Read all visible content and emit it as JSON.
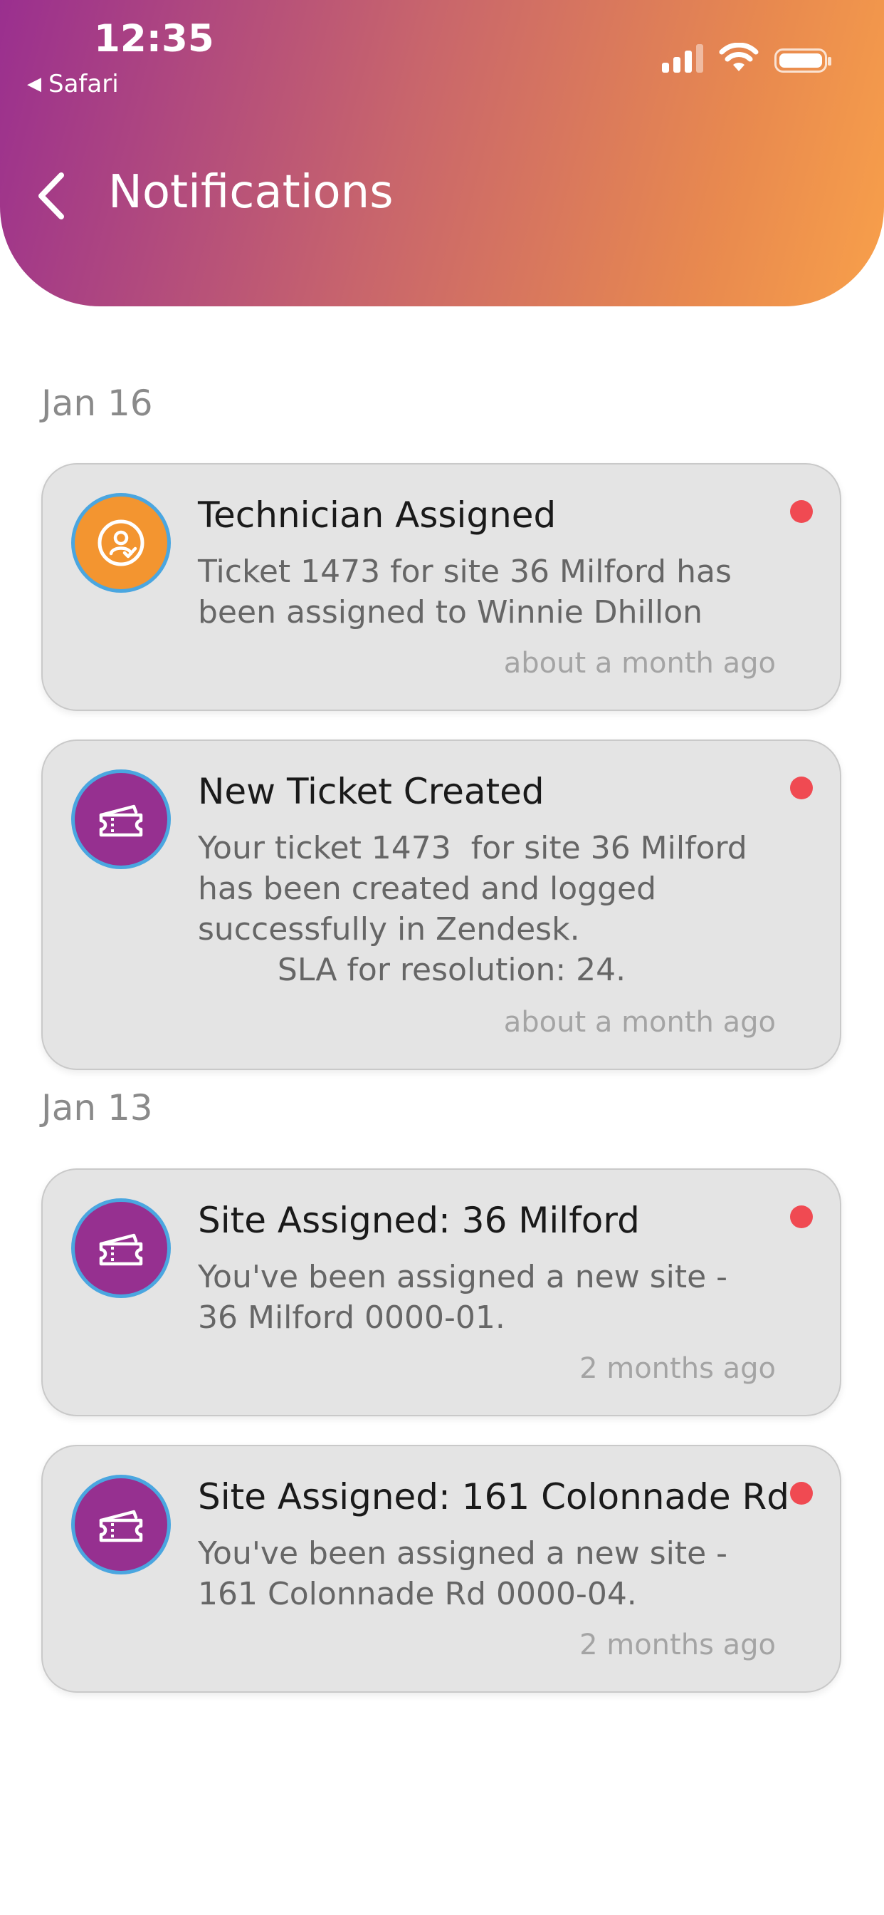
{
  "status_bar": {
    "time": "12:35",
    "back_app": "Safari"
  },
  "header": {
    "title": "Notifications"
  },
  "sections": [
    {
      "date": "Jan 16"
    },
    {
      "date": "Jan 13"
    }
  ],
  "notifications": [
    {
      "icon": "technician-assigned-icon",
      "title": "Technician Assigned",
      "body": "Ticket 1473 for site 36 Milford has\nbeen assigned to Winnie Dhillon",
      "time": "about a month ago",
      "unread": true
    },
    {
      "icon": "ticket-icon",
      "title": "New Ticket Created",
      "body": "Your ticket 1473  for site 36 Milford\nhas been created and logged\nsuccessfully in Zendesk.\n        SLA for resolution: 24.",
      "time": "about a month ago",
      "unread": true
    },
    {
      "icon": "ticket-icon",
      "title": "Site Assigned: 36 Milford",
      "body": "You've been assigned a new site -\n36 Milford 0000-01.",
      "time": "2 months ago",
      "unread": true
    },
    {
      "icon": "ticket-icon",
      "title": "Site Assigned: 161 Colonnade Rd",
      "body": "You've been assigned a new site -\n161 Colonnade Rd 0000-04.",
      "time": "2 months ago",
      "unread": true
    }
  ],
  "colors": {
    "gradient_start": "#9a2f8f",
    "gradient_end": "#f8a04a",
    "unread_dot": "#f04a52",
    "icon_orange": "#f39530",
    "icon_purple": "#963090",
    "icon_ring": "#4aa6e0"
  }
}
